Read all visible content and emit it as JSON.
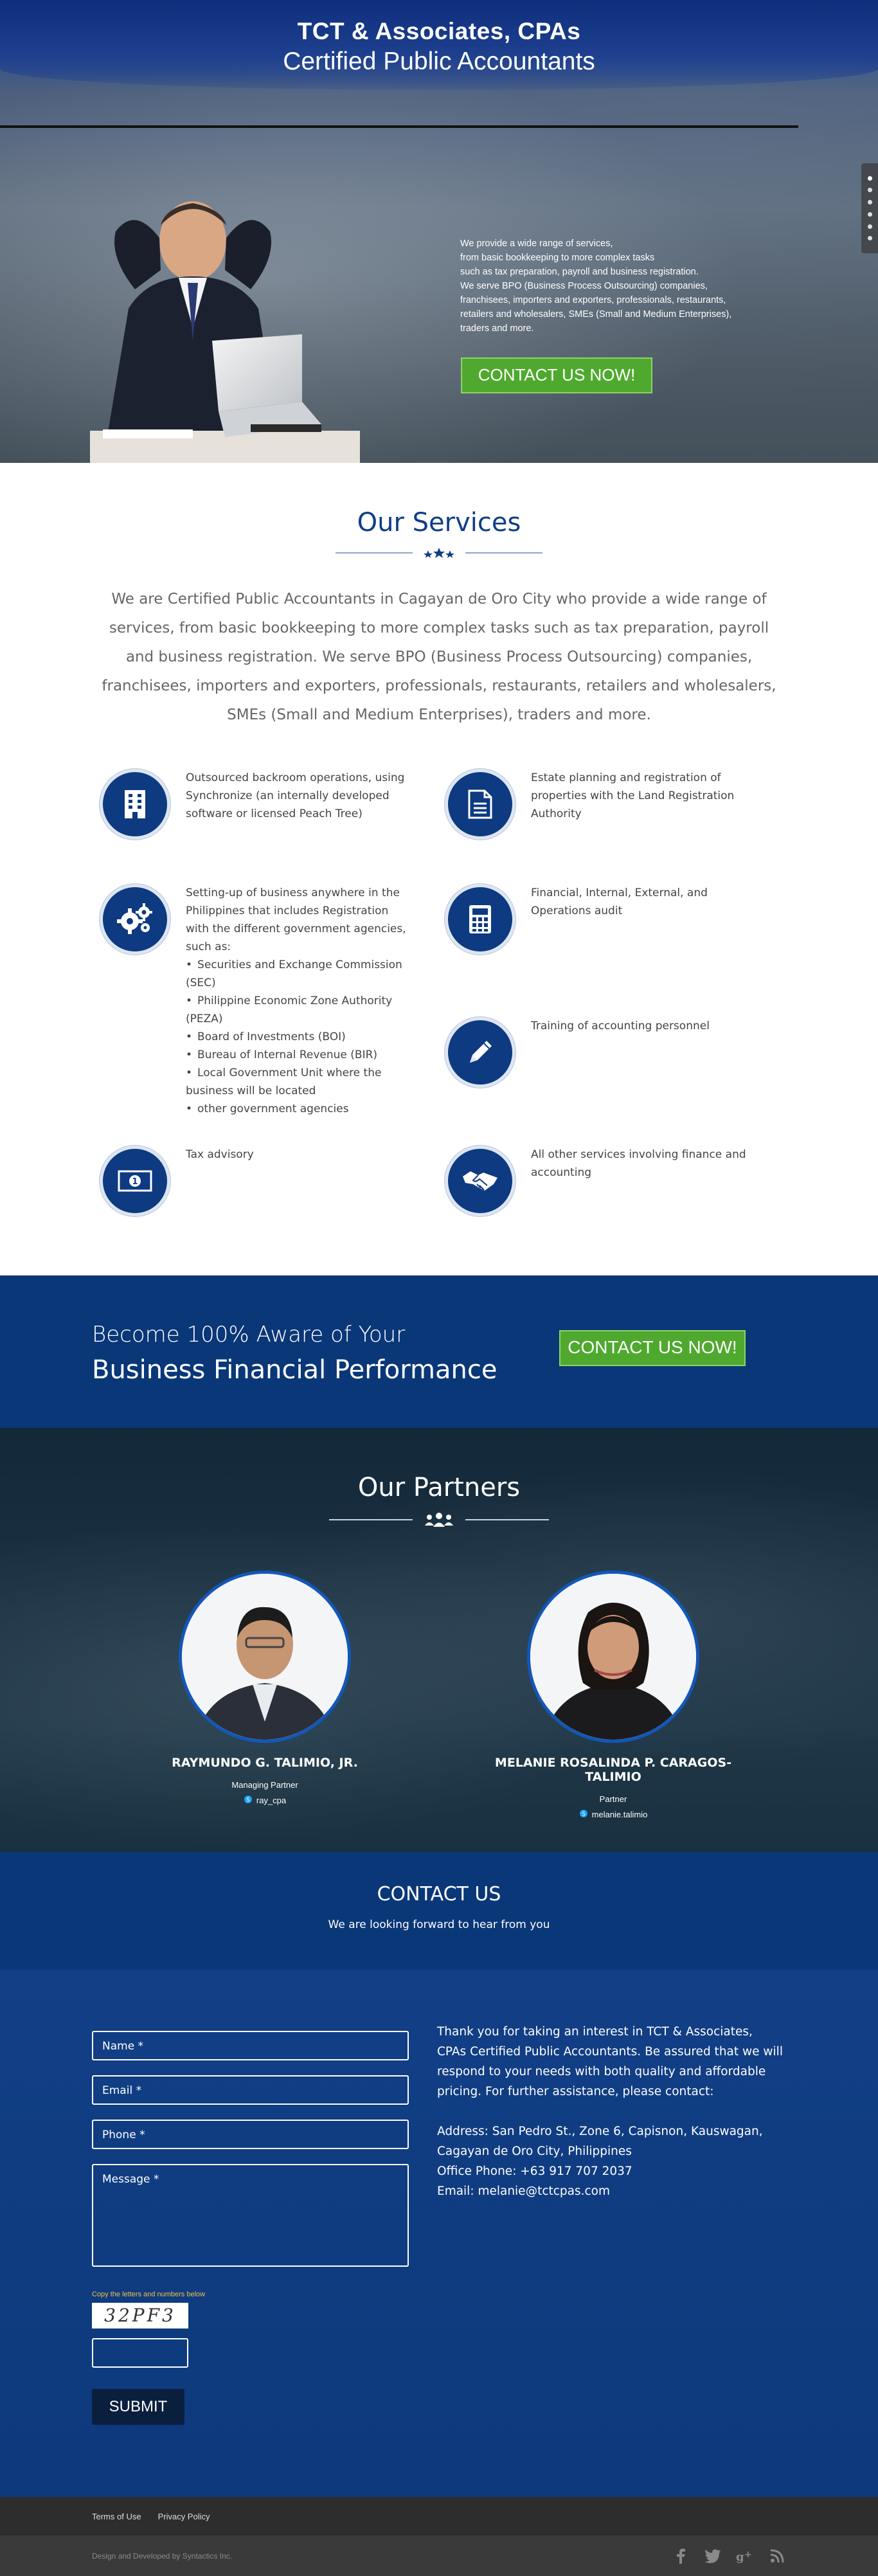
{
  "hero": {
    "title": "TCT & Associates, CPAs",
    "subtitle": "Certified Public Accountants",
    "copy": [
      "We provide a wide range of services,",
      "from basic bookkeeping to more complex tasks",
      "such as tax preparation, payroll and business registration.",
      "We serve BPO (Business Process Outsourcing) companies,",
      "franchisees, importers and exporters, professionals, restaurants,",
      "retailers and wholesalers, SMEs (Small and Medium Enterprises),",
      "traders and more."
    ],
    "cta_label": "CONTACT US NOW!",
    "slides": 6
  },
  "services": {
    "title": "Our Services",
    "intro": "We are Certified Public Accountants in Cagayan de Oro City who provide a wide range of services, from basic bookkeeping to more complex tasks such as tax preparation, payroll and business registration. We serve BPO (Business Process Outsourcing) companies, franchisees, importers and exporters, professionals, restaurants, retailers and wholesalers, SMEs (Small and Medium Enterprises), traders and more.",
    "items": [
      {
        "icon": "building-icon",
        "text": "Outsourced backroom operations, using Synchronize (an internally developed software or licensed Peach Tree)"
      },
      {
        "icon": "document-icon",
        "text": "Estate planning and registration of properties with the Land Registration Authority"
      },
      {
        "icon": "gears-icon",
        "text": "Setting-up of business anywhere in the Philippines that includes Registration with the different government agencies, such as:",
        "bullets": [
          "Securities and Exchange Commission (SEC)",
          "Philippine Economic Zone Authority (PEZA)",
          "Board of Investments (BOI)",
          "Bureau of Internal Revenue (BIR)",
          "Local Government Unit where the business will be located",
          "other government agencies"
        ]
      },
      {
        "icon": "calculator-icon",
        "text": "Financial, Internal, External, and Operations audit"
      },
      {
        "icon": "pencil-icon",
        "text": "Training of accounting personnel"
      },
      {
        "icon": "money-icon",
        "text": "Tax advisory"
      },
      {
        "icon": "handshake-icon",
        "text": "All other services involving finance and accounting"
      }
    ]
  },
  "cta_band": {
    "line1": "Become 100% Aware of Your",
    "line2": "Business Financial Performance",
    "button": "CONTACT US NOW!"
  },
  "partners": {
    "title": "Our Partners",
    "people": [
      {
        "name": "RAYMUNDO G. TALIMIO, JR.",
        "role": "Managing Partner",
        "skype": "ray_cpa"
      },
      {
        "name": "MELANIE ROSALINDA P. CARAGOS-TALIMIO",
        "role": "Partner",
        "skype": "melanie.talimio"
      }
    ]
  },
  "contact": {
    "title": "CONTACT US",
    "subtitle": "We are looking forward to hear from you",
    "fields": {
      "name": "Name *",
      "email": "Email *",
      "phone": "Phone *",
      "message": "Message *"
    },
    "captcha_label": "Copy the letters and numbers below",
    "captcha_text": "32PF3",
    "submit": "SUBMIT",
    "info": {
      "intro": "Thank you for taking an interest in TCT & Associates, CPAs Certified Public Accountants. Be assured that we will respond to your needs with both quality and affordable pricing. For further assistance, please contact:",
      "address": "Address: San Pedro St., Zone 6, Capisnon, Kauswagan, Cagayan de Oro City, Philippines",
      "phone": "Office Phone: +63 917 707 2037",
      "email": "Email: melanie@tctcpas.com"
    }
  },
  "footer": {
    "terms": "Terms of Use",
    "privacy": "Privacy Policy",
    "credit": "Design and Developed by Syntactics Inc.",
    "social": [
      "facebook-icon",
      "twitter-icon",
      "google-plus-icon",
      "rss-icon"
    ]
  },
  "colors": {
    "brand_blue": "#0a3778",
    "accent_green": "#4fa92e",
    "title_blue": "#0f3d87"
  }
}
